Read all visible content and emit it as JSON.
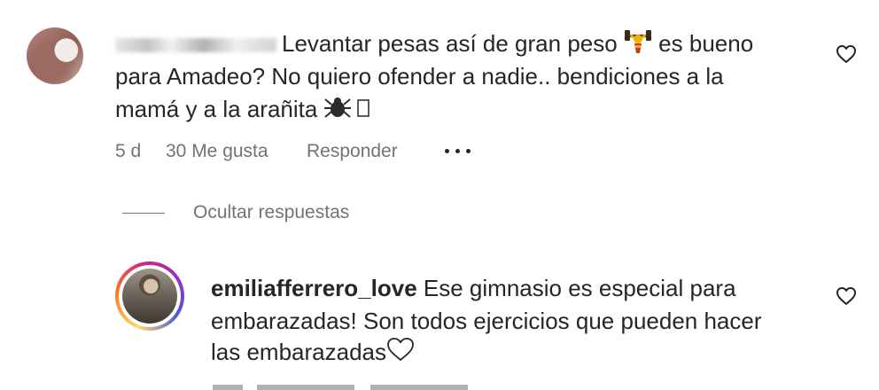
{
  "comments": [
    {
      "username": "",
      "text_line1": "Levantar pesas así de gran peso",
      "text_line1b": "es bueno",
      "text_line2": "para Amadeo? No quiero ofender a nadie.. bendiciones a la",
      "text_line3": "mamá y a la arañita",
      "time": "5 d",
      "likes": "30 Me gusta",
      "reply_label": "Responder",
      "more_label": "•••",
      "hide_replies_label": "Ocultar respuestas"
    },
    {
      "username": "emiliafferrero_love",
      "text_line1": "Ese gimnasio es especial para",
      "text_line2": "embarazadas! Son todos ejercicios que pueden hacer",
      "text_line3": "las embarazadas"
    }
  ],
  "icons": {
    "heart": "heart-icon",
    "weightlift": "weightlifter-emoji",
    "spider": "spider-emoji",
    "missing_glyph": "missing-glyph",
    "heart_outline_emoji": "white-heart-emoji"
  },
  "colors": {
    "text_primary": "#262626",
    "text_secondary": "#737373",
    "story_ring_start": "#feda75",
    "story_ring_end": "#962fbf"
  }
}
